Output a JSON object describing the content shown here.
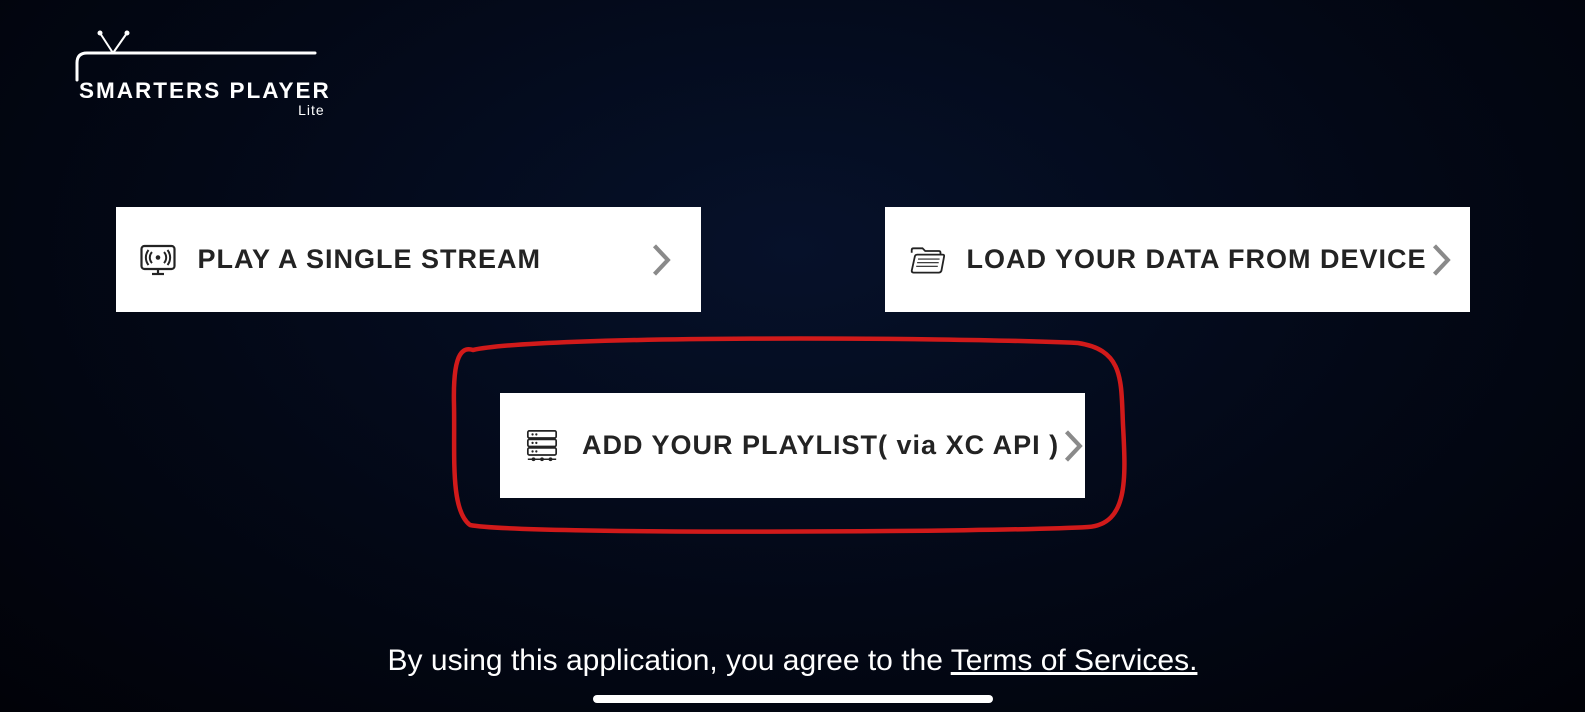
{
  "app": {
    "name": "SMARTERS PLAYER",
    "sub": "Lite"
  },
  "options": {
    "single_stream": {
      "label": "PLAY A SINGLE STREAM",
      "icon": "broadcast-monitor-icon"
    },
    "load_device": {
      "label": "LOAD YOUR DATA FROM DEVICE",
      "icon": "folder-open-icon"
    },
    "xc_api": {
      "label": "ADD YOUR PLAYLIST( via XC API )",
      "icon": "server-stack-icon"
    }
  },
  "footer": {
    "agree_prefix": "By using this application, you agree to the ",
    "tos_label": "Terms of Services."
  }
}
